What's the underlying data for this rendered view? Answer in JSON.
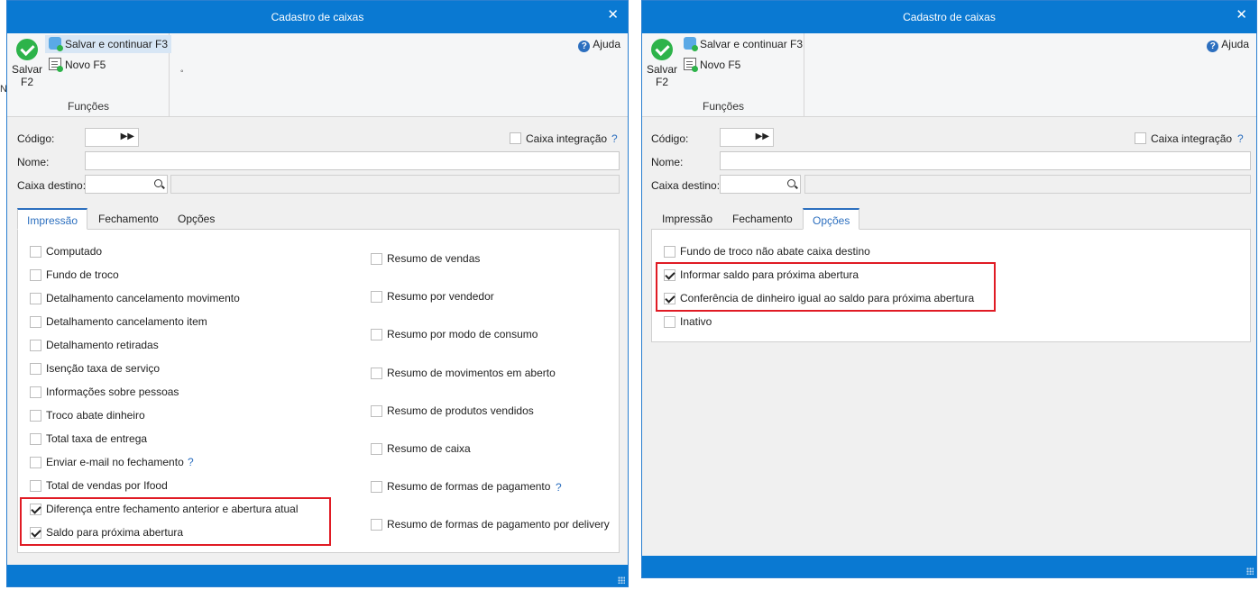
{
  "background_fragment": "N",
  "left_window": {
    "title": "Cadastro de caixas",
    "ribbon": {
      "save_label_line1": "Salvar",
      "save_label_line2": "F2",
      "save_continue": "Salvar e continuar F3",
      "new": "Novo F5",
      "group_label": "Funções",
      "help": "Ajuda",
      "dot": "◦"
    },
    "form": {
      "codigo_label": "Código:",
      "nome_label": "Nome:",
      "caixa_destino_label": "Caixa destino:",
      "caixa_integracao_label": "Caixa integração",
      "caixa_integracao_checked": false,
      "help_mark": "?"
    },
    "tabs": [
      {
        "label": "Impressão",
        "active": true
      },
      {
        "label": "Fechamento",
        "active": false
      },
      {
        "label": "Opções",
        "active": false
      }
    ],
    "col1": [
      {
        "label": "Computado",
        "checked": false
      },
      {
        "label": "Fundo de troco",
        "checked": false
      },
      {
        "label": "Detalhamento cancelamento movimento",
        "checked": false
      },
      {
        "label": "Detalhamento cancelamento item",
        "checked": false
      },
      {
        "label": "Detalhamento retiradas",
        "checked": false
      },
      {
        "label": "Isenção taxa de serviço",
        "checked": false
      },
      {
        "label": "Informações sobre pessoas",
        "checked": false
      },
      {
        "label": "Troco abate dinheiro",
        "checked": false
      },
      {
        "label": "Total taxa de entrega",
        "checked": false
      },
      {
        "label": "Enviar e-mail no fechamento",
        "checked": false
      },
      {
        "label": "Total de vendas por Ifood",
        "checked": false
      },
      {
        "label": "Diferença entre fechamento anterior e abertura atual",
        "checked": true
      },
      {
        "label": "Saldo para próxima abertura",
        "checked": true
      }
    ],
    "col2": [
      {
        "label": "Resumo de vendas",
        "checked": false
      },
      {
        "label": "Resumo por vendedor",
        "checked": false
      },
      {
        "label": "Resumo por modo de consumo",
        "checked": false
      },
      {
        "label": "Resumo de movimentos em aberto",
        "checked": false
      },
      {
        "label": "Resumo de produtos vendidos",
        "checked": false
      },
      {
        "label": "Resumo de caixa",
        "checked": false
      },
      {
        "label": "Resumo de formas de pagamento",
        "checked": false
      },
      {
        "label": "Resumo de formas de pagamento por delivery",
        "checked": false
      }
    ]
  },
  "right_window": {
    "title": "Cadastro de caixas",
    "ribbon": {
      "save_label_line1": "Salvar",
      "save_label_line2": "F2",
      "save_continue": "Salvar e continuar F3",
      "new": "Novo F5",
      "group_label": "Funções",
      "help": "Ajuda"
    },
    "form": {
      "codigo_label": "Código:",
      "nome_label": "Nome:",
      "caixa_destino_label": "Caixa destino:",
      "caixa_integracao_label": "Caixa integração",
      "caixa_integracao_checked": false,
      "help_mark": "?"
    },
    "tabs": [
      {
        "label": "Impressão",
        "active": false
      },
      {
        "label": "Fechamento",
        "active": false
      },
      {
        "label": "Opções",
        "active": true
      }
    ],
    "options": [
      {
        "label": "Fundo de troco não abate caixa destino",
        "checked": false
      },
      {
        "label": "Informar saldo para próxima abertura",
        "checked": true
      },
      {
        "label": "Conferência de dinheiro igual ao saldo para próxima abertura",
        "checked": true
      },
      {
        "label": "Inativo",
        "checked": false
      }
    ]
  },
  "colors": {
    "titlebar": "#0a79d2",
    "highlight_box": "#e01b24",
    "active_tab": "#2c6fbf",
    "check_green": "#2db34a"
  }
}
